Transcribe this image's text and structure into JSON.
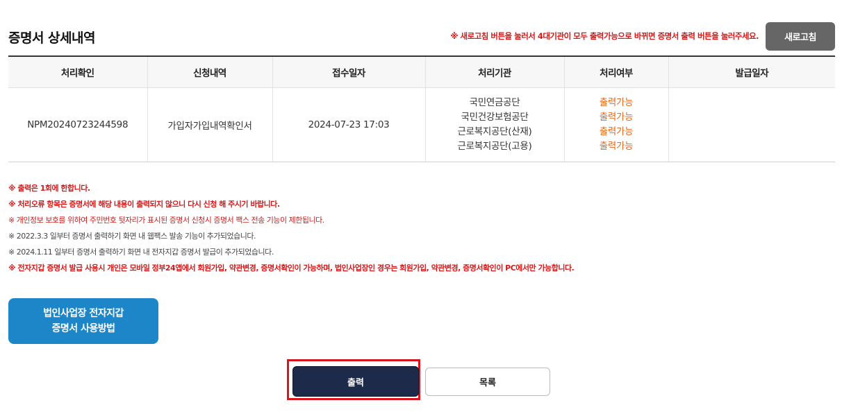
{
  "header": {
    "title": "증명서 상세내역",
    "notice": "※ 새로고침 버튼을 눌러서 4대기관이 모두 출력가능으로 바뀌면 증명서 출력 버튼을 눌러주세요.",
    "refresh_label": "새로고침"
  },
  "table": {
    "headers": [
      "처리확인",
      "신청내역",
      "접수일자",
      "처리기관",
      "처리여부",
      "발급일자"
    ],
    "row": {
      "confirm_no": "NPM20240723244598",
      "request": "가입자가입내역확인서",
      "received": "2024-07-23 17:03",
      "agencies": [
        "국민연금공단",
        "국민건강보험공단",
        "근로복지공단(산재)",
        "근로복지공단(고용)"
      ],
      "statuses": [
        "출력가능",
        "출력가능",
        "출력가능",
        "출력가능"
      ],
      "issued": ""
    }
  },
  "notes": [
    "※ 출력은 1회에 한합니다.",
    "※ 처리오류 항목은 증명서에 해당 내용이 출력되지 않으니 다시 신청 해 주시기 바랍니다.",
    "※ 개인정보 보호를 위하여 주민번호 뒷자리가 표시된 증명서 신청시 증명서 팩스 전송 기능이 제한됩니다.",
    "※ 2022.3.3 일부터 증명서 출력하기 화면 내 웹팩스 발송 기능이 추가되었습니다.",
    "※ 2024.1.11 일부터 증명서 출력하기 화면 내 전자지갑 증명서 발급이 추가되었습니다.",
    "※ 전자지갑 증명서 발급 사용시 개인은 모바일 정부24앱에서 회원가입, 약관변경, 증명서확인이 가능하며, 법인사업장인 경우는 회원가입, 약관변경, 증명서확인이 PC에서만 가능합니다."
  ],
  "guide_button": {
    "line1": "법인사업장 전자지갑",
    "line2": "증명서 사용방법"
  },
  "actions": {
    "print_label": "출력",
    "list_label": "목록"
  },
  "colors": {
    "notice_red": "#d31a1a",
    "status_orange": "#e26a1f",
    "guide_blue": "#1d86c8",
    "print_navy": "#1e2a4a",
    "highlight_red": "#d8141c"
  }
}
